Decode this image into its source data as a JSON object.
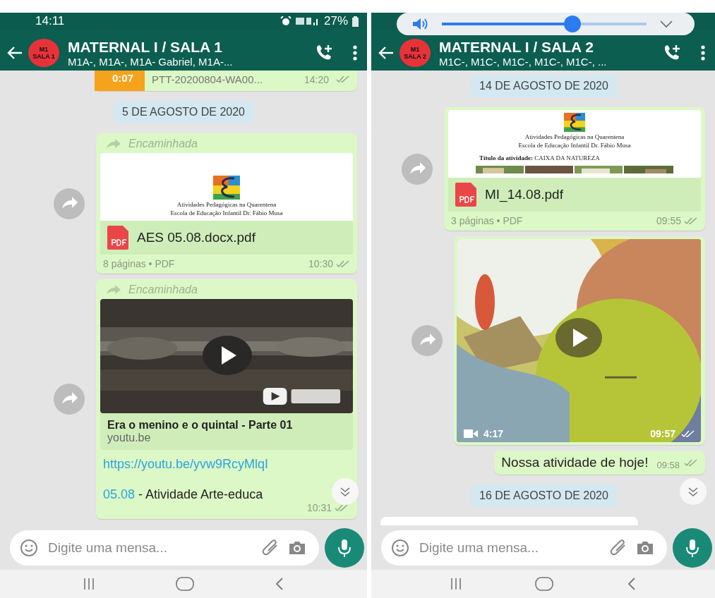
{
  "phones": [
    {
      "status_bar": {
        "time": "14:11",
        "battery": "27%"
      },
      "header": {
        "avatar_lines": [
          "M1",
          "SALA 1"
        ],
        "title": "MATERNAL I / SALA 1",
        "subtitle": "M1A-, M1A-, M1A- Gabriel, M1A-..."
      },
      "messages": [
        {
          "kind": "voice",
          "duration": "0:07",
          "file": "PTT-20200804-WA00...",
          "time": "14:20"
        },
        {
          "kind": "date",
          "text": "5 DE AGOSTO DE 2020"
        },
        {
          "kind": "document",
          "forwarded": "Encaminhada",
          "preview_lines": [
            "Atividades Pedagógicas na Quarentena",
            "Escola de Educação Infantil Dr. Fábio Musa"
          ],
          "file": "AES 05.08.docx.pdf",
          "info": "8 páginas • PDF",
          "time": "10:30"
        },
        {
          "kind": "link",
          "forwarded": "Encaminhada",
          "title": "Era o menino e o quintal - Parte 01",
          "domain": "youtu.be",
          "url": "https://youtu.be/yvw9RcyMlqI",
          "caption_link": "05.08",
          "caption": " - Atividade Arte-educa",
          "time": "10:31"
        }
      ],
      "composer": {
        "placeholder": "Digite uma mensa..."
      }
    },
    {
      "volume_popup": {
        "level": 0.64
      },
      "header": {
        "avatar_lines": [
          "M1",
          "SALA 2"
        ],
        "title": "MATERNAL I / SALA 2",
        "subtitle": "M1C-, M1C-, M1C-, M1C-, M1C-, ..."
      },
      "messages": [
        {
          "kind": "date",
          "text": "14 DE AGOSTO DE 2020"
        },
        {
          "kind": "document",
          "preview_lines": [
            "Atividades Pedagógicas na Quarentena",
            "Escola de Educação Infantil Dr. Fábio Musa"
          ],
          "preview_heading": "**Título da atividade:** CAIXA DA NATUREZA",
          "photo_strip": true,
          "file": "MI_14.08.pdf",
          "info": "3 páginas • PDF",
          "time": "09:55"
        },
        {
          "kind": "video",
          "duration": "4:17",
          "time": "09:57"
        },
        {
          "kind": "text",
          "text": "Nossa atividade de hoje!",
          "time": "09:58"
        },
        {
          "kind": "date",
          "text": "16 DE AGOSTO DE 2020"
        },
        {
          "kind": "incoming_cut"
        }
      ],
      "composer": {
        "placeholder": "Digite uma mensa..."
      }
    }
  ]
}
